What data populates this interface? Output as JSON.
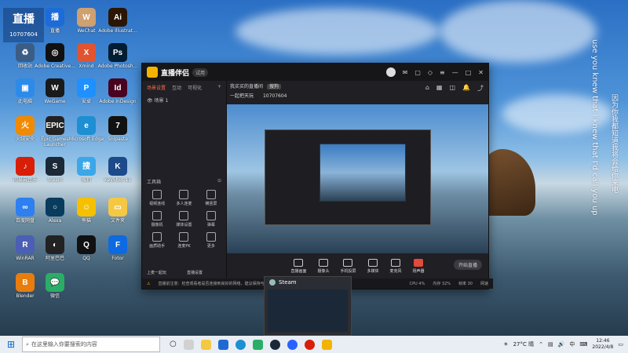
{
  "desktop_badge": {
    "line1": "直播",
    "line2": "10707604"
  },
  "desktop_icons": [
    {
      "label": "直播",
      "bg": "#1c6bd8",
      "glyph": "播"
    },
    {
      "label": "WeChat",
      "bg": "#cfa070",
      "glyph": "W"
    },
    {
      "label": "Adobe Illustrat...",
      "bg": "#2b1505",
      "glyph": "Ai"
    },
    {
      "label": "回收站",
      "bg": "#3b5d85",
      "glyph": "♻"
    },
    {
      "label": "Adobe Creative...",
      "bg": "#111",
      "glyph": "◎"
    },
    {
      "label": "Xmind",
      "bg": "#e2532f",
      "glyph": "X"
    },
    {
      "label": "Adobe Photosh...",
      "bg": "#001d34",
      "glyph": "Ps"
    },
    {
      "label": "此电脑",
      "bg": "#2d8ae8",
      "glyph": "▣"
    },
    {
      "label": "WeGame",
      "bg": "#1a1a1a",
      "glyph": "W"
    },
    {
      "label": "安卓",
      "bg": "#1e90ff",
      "glyph": "P"
    },
    {
      "label": "Adobe InDesign",
      "bg": "#49021f",
      "glyph": "Id"
    },
    {
      "label": "火绒安全",
      "bg": "#f08a00",
      "glyph": "火"
    },
    {
      "label": "Epic Games Launcher",
      "bg": "#222",
      "glyph": "EPIC"
    },
    {
      "label": "Microsoft Edge",
      "bg": "#1d8fd2",
      "glyph": "e"
    },
    {
      "label": "Snipaste",
      "bg": "#111",
      "glyph": "7"
    },
    {
      "label": "网易云音乐",
      "bg": "#d81e06",
      "glyph": "♪"
    },
    {
      "label": "Steam",
      "bg": "#1b2838",
      "glyph": "S"
    },
    {
      "label": "搜狗",
      "bg": "#3aa7e8",
      "glyph": "搜"
    },
    {
      "label": "KeyShot 11",
      "bg": "#1c4a8a",
      "glyph": "K"
    },
    {
      "label": "百度网盘",
      "bg": "#2e7ff0",
      "glyph": "∞"
    },
    {
      "label": "Alexa",
      "bg": "#083b5c",
      "glyph": "○"
    },
    {
      "label": "熊猫",
      "bg": "#f5c000",
      "glyph": "☺"
    },
    {
      "label": "文件夹",
      "bg": "#f5c842",
      "glyph": "▭"
    },
    {
      "label": "WinRAR",
      "bg": "#4b5fb5",
      "glyph": "R"
    },
    {
      "label": "阿里巴巴",
      "bg": "#222",
      "glyph": "◐"
    },
    {
      "label": "QQ",
      "bg": "#111",
      "glyph": "Q"
    },
    {
      "label": "Fotor",
      "bg": "#0d6ae0",
      "glyph": "F"
    },
    {
      "label": "Blender",
      "bg": "#e87d0d",
      "glyph": "B"
    },
    {
      "label": "微信",
      "bg": "#2aae67",
      "glyph": "💬"
    }
  ],
  "vertical_text": {
    "line_a": "use you knew that I knew that I'd call you up",
    "line_b": "因为你我都知道我将会给你来电"
  },
  "window": {
    "title": "直播伴侣",
    "version": "试用",
    "left_tabs": [
      "场景设置",
      "互动",
      "可视化"
    ],
    "scene_item": "场景 1",
    "tools_header": "工具箱",
    "tools": [
      "视频连线",
      "多人连麦",
      "横竖屏",
      "摄像机",
      "媒体设置",
      "弹幕",
      "画质助手",
      "连麦PK",
      "更多"
    ],
    "bottom_left": [
      "上麦一起玩",
      "直播设置"
    ],
    "stream_title": "我买买的直播间",
    "stream_tag": "搜狗",
    "room_label": "一起把天玩",
    "room_id": "10707604",
    "controls": [
      "直播画面",
      "摄像头",
      "手机投屏",
      "多媒体",
      "麦克风",
      "扬声器"
    ],
    "start_button": "开始直播",
    "status_warning": "直播前注意：检查观看者是否连接到良好的网络，建议保持与观看者的良好连接",
    "status_right": [
      "CPU 4%",
      "内存 32%",
      "帧率 30",
      "网速"
    ]
  },
  "steam_window": {
    "title": "Steam"
  },
  "taskbar": {
    "search_placeholder": "在这里输入你要搜索的内容",
    "weather": "27°C 晴",
    "ime": "中",
    "time": "12:46",
    "date": "2022/4/8"
  }
}
